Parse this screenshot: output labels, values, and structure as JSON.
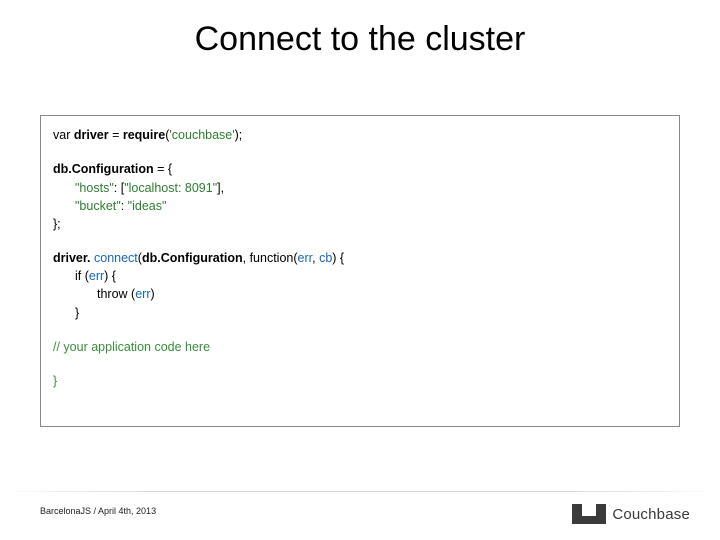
{
  "slide": {
    "title": "Connect to the cluster",
    "footer": "BarcelonaJS / April 4th, 2013",
    "brand": "Couchbase"
  },
  "code": {
    "l1_var": "var ",
    "l1_driver": "driver",
    "l1_eq": " = ",
    "l1_require": "require",
    "l1_open": "(",
    "l1_arg": "'couchbase'",
    "l1_close": ");",
    "l2_id": "db.Configuration",
    "l2_rest": " = {",
    "l3_key": "\"hosts\"",
    "l3_colon": ": [",
    "l3_val": "\"localhost: 8091\"",
    "l3_end": "],",
    "l4_key": "\"bucket\"",
    "l4_colon": ": ",
    "l4_val": "\"ideas\"",
    "l5": "};",
    "l6_driver": "driver. ",
    "l6_connect": "connect",
    "l6_open": "(",
    "l6_conf": "db.Configuration",
    "l6_comma": ", function(",
    "l6_err": "err",
    "l6_c2": ", ",
    "l6_cb": "cb",
    "l6_end": ") {",
    "l7_if": "if (",
    "l7_err": "err",
    "l7_end": ") {",
    "l8_throw": "throw (",
    "l8_err": "err",
    "l8_end": ")",
    "l9": "}",
    "l10_slashes": "// ",
    "l10_text": "your application code here",
    "l11": "}"
  }
}
